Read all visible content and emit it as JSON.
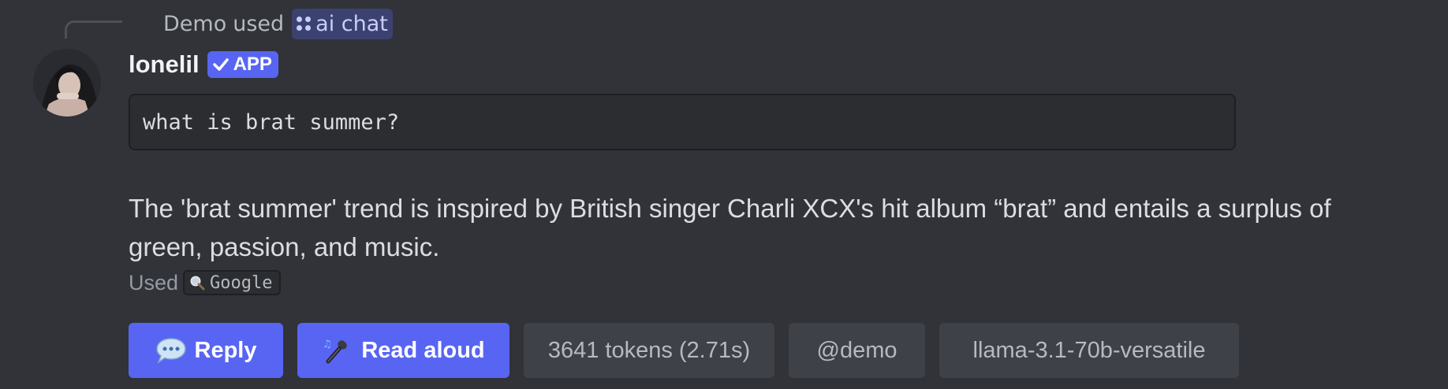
{
  "reply_header": {
    "user": "Demo",
    "used_text": "used",
    "command": "ai chat"
  },
  "author": {
    "name": "lonelil",
    "badge": "APP"
  },
  "code_block": {
    "text": "what is brat summer?"
  },
  "answer": {
    "text": "The 'brat summer' trend is inspired by British singer Charli XCX's hit album “brat” and entails a surplus of green, passion, and music."
  },
  "tool_usage": {
    "label": "Used",
    "tool_icon": "magnifying-glass-icon",
    "tool_name": "Google"
  },
  "buttons": {
    "reply": {
      "label": "Reply",
      "icon": "speech-balloon-icon"
    },
    "read_aloud": {
      "label": "Read aloud",
      "icon": "microphone-icon"
    },
    "tokens": {
      "label": "3641 tokens (2.71s)"
    },
    "mention": {
      "label": "@demo"
    },
    "model": {
      "label": "llama-3.1-70b-versatile"
    }
  },
  "colors": {
    "background": "#313338",
    "blurple": "#5865f2",
    "secondary_button": "#3f4148",
    "code_bg": "#2b2d31"
  }
}
